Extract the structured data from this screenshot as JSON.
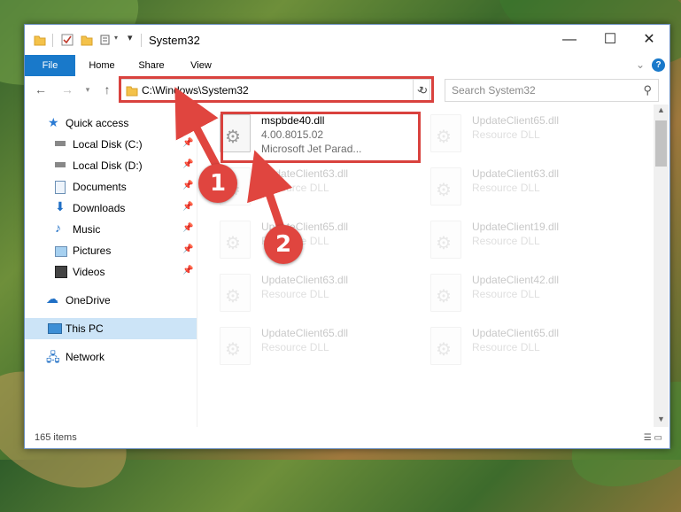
{
  "window": {
    "title": "System32"
  },
  "ribbon": {
    "tabs": [
      "File",
      "Home",
      "Share",
      "View"
    ]
  },
  "address": {
    "path": "C:\\Windows\\System32"
  },
  "search": {
    "placeholder": "Search System32"
  },
  "sidebar": {
    "items": [
      {
        "label": "Quick access",
        "icon": "star-icon"
      },
      {
        "label": "Local Disk (C:)",
        "icon": "drive-icon",
        "pinned": true
      },
      {
        "label": "Local Disk (D:)",
        "icon": "drive-icon",
        "pinned": true
      },
      {
        "label": "Documents",
        "icon": "documents-icon",
        "pinned": true
      },
      {
        "label": "Downloads",
        "icon": "downloads-icon",
        "pinned": true
      },
      {
        "label": "Music",
        "icon": "music-icon",
        "pinned": true
      },
      {
        "label": "Pictures",
        "icon": "pictures-icon",
        "pinned": true
      },
      {
        "label": "Videos",
        "icon": "videos-icon",
        "pinned": true
      },
      {
        "label": "OneDrive",
        "icon": "cloud-icon"
      },
      {
        "label": "This PC",
        "icon": "computer-icon",
        "selected": true
      },
      {
        "label": "Network",
        "icon": "network-icon"
      }
    ]
  },
  "files": [
    {
      "name": "mspbde40.dll",
      "version": "4.00.8015.02",
      "desc": "Microsoft Jet Parad..."
    },
    {
      "name": "UpdateClient65.dll",
      "desc": "Resource DLL"
    },
    {
      "name": "UpdateClient63.dll",
      "desc": "Resource DLL"
    },
    {
      "name": "UpdateClient63.dll",
      "desc": "Resource DLL"
    },
    {
      "name": "UpdateClient65.dll",
      "desc": "Resource DLL"
    },
    {
      "name": "UpdateClient19.dll",
      "desc": "Resource DLL"
    },
    {
      "name": "UpdateClient63.dll",
      "desc": "Resource DLL"
    },
    {
      "name": "UpdateClient42.dll",
      "desc": "Resource DLL"
    },
    {
      "name": "UpdateClient65.dll",
      "desc": "Resource DLL"
    },
    {
      "name": "UpdateClient65.dll",
      "desc": "Resource DLL"
    }
  ],
  "status": {
    "count": "165 items"
  },
  "annotations": {
    "badge1": "1",
    "badge2": "2",
    "color": "#d9423e"
  }
}
